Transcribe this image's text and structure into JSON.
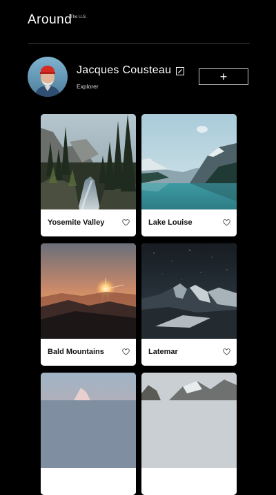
{
  "app": {
    "title": "Around",
    "title_superscript": "The U.S."
  },
  "profile": {
    "name": "Jacques Cousteau",
    "role": "Explorer"
  },
  "actions": {
    "add_label": "+"
  },
  "cards": [
    {
      "title": "Yosemite Valley"
    },
    {
      "title": "Lake Louise"
    },
    {
      "title": "Bald Mountains"
    },
    {
      "title": "Latemar"
    },
    {
      "title": ""
    },
    {
      "title": ""
    }
  ]
}
